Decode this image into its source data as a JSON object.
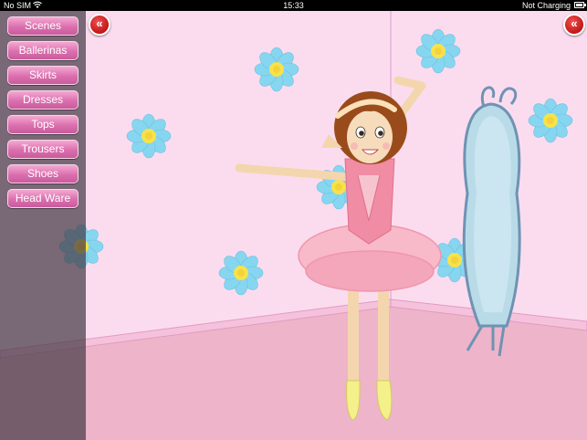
{
  "status_bar": {
    "carrier": "No SIM",
    "time": "15:33",
    "charging": "Not Charging"
  },
  "menu": {
    "items": [
      {
        "label": "Scenes"
      },
      {
        "label": "Ballerinas"
      },
      {
        "label": "Skirts"
      },
      {
        "label": "Dresses"
      },
      {
        "label": "Tops"
      },
      {
        "label": "Trousers"
      },
      {
        "label": "Shoes"
      },
      {
        "label": "Head Ware"
      }
    ]
  },
  "buttons": {
    "left_collapse_icon": "double-chevron-left-icon",
    "right_collapse_icon": "double-chevron-left-icon",
    "glyph": "«"
  },
  "colors": {
    "wall": "#fbdcef",
    "floor": "#eeb4c9",
    "menu_button": "#db6fae",
    "accent_red": "#c31616",
    "flower_petal": "#87d6f0",
    "flower_center": "#f8e24a",
    "tutu": "#f8b9c8",
    "mirror": "#b9dbe8"
  }
}
